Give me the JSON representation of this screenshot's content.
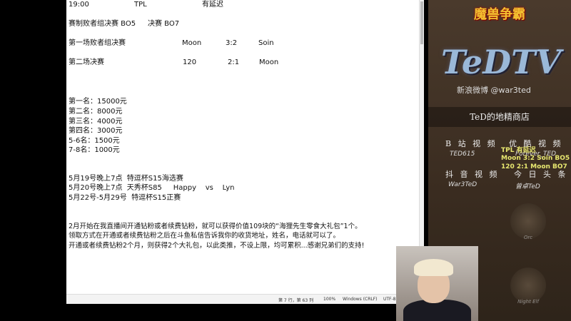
{
  "editor": {
    "line1": {
      "time": "19:00",
      "event": "TPL",
      "note": "有延迟"
    },
    "line2": {
      "a": "赛制败者组决赛  BO5",
      "b": "决赛  BO7"
    },
    "match1": {
      "label": "第一场败者组决赛",
      "p1": "Moon",
      "score": "3:2",
      "p2": "Soin"
    },
    "match2": {
      "label": "第二场决赛",
      "p1": "120",
      "score": "2:1",
      "p2": "Moon"
    },
    "prizes": [
      "第一名：15000元",
      "第二名：8000元",
      "第三名：4000元",
      "第四名：3000元",
      "5-6名：1500元",
      "7-8名：1000元"
    ],
    "schedule": [
      "5月19号晚上7点  特逗杯S15海选赛",
      "5月20号晚上7点  天秀杯S85     Happy    vs    Lyn",
      "5月22号-5月29号  特逗杯S15正赛"
    ],
    "notice": [
      "2月开始在我直播间开通钻粉或者续费钻粉，就可以获得价值109块的“海狸先生零食大礼包”1个。",
      "领取方式在开通或者续费钻粉之后在斗鱼私信告诉我你的收货地址，姓名，电话就可以了。",
      "开通或者续费钻粉2个月，则获得2个大礼包，以此类推，不设上限，均可累积...感谢兄弟们的支持!"
    ]
  },
  "status": {
    "position": "第 7 行，第 63 列",
    "zoom": "100%",
    "eol": "Windows (CRLF)",
    "encoding": "UTF-8"
  },
  "panel": {
    "game_logo": "魔兽争霸",
    "brand": "TeDTV",
    "weibo": "新浪微博 @war3ted",
    "shop": "TeD的地精商店",
    "links": [
      {
        "label": "B 站 视 频",
        "value": "TED615"
      },
      {
        "label": "优 酷 视 频",
        "value": "Forever_TED"
      },
      {
        "label": "抖 音 视 频",
        "value": "War3TeD"
      },
      {
        "label": "今 日 头 条",
        "value": "曾卓TeD"
      }
    ],
    "overlay": [
      "TPL  有延迟",
      "Moon 3:2 Soin BO5",
      "120 2:1 Moon BO7"
    ],
    "races": [
      "Orc",
      "Night Elf"
    ]
  }
}
